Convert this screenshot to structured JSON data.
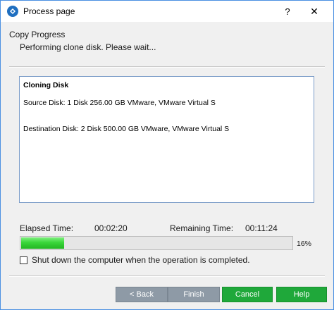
{
  "window": {
    "title": "Process page",
    "help_glyph": "?",
    "close_glyph": "✕",
    "icon": "app-logo-icon"
  },
  "header": {
    "title": "Copy Progress",
    "subtitle": "Performing clone disk. Please wait..."
  },
  "log": {
    "title": "Cloning Disk",
    "source": "Source Disk: 1 Disk 256.00 GB VMware, VMware Virtual S",
    "destination": "Destination Disk: 2 Disk 500.00 GB VMware, VMware Virtual S"
  },
  "progress": {
    "elapsed_label": "Elapsed Time:",
    "elapsed_value": "00:02:20",
    "remaining_label": "Remaining Time:",
    "remaining_value": "00:11:24",
    "percent_text": "16%",
    "percent": 16
  },
  "shutdown": {
    "label": "Shut down the computer when the operation is completed.",
    "checked": false
  },
  "buttons": {
    "back": "< Back",
    "finish": "Finish",
    "cancel": "Cancel",
    "help": "Help"
  },
  "colors": {
    "accent_green": "#1fa83a",
    "disabled_gray": "#8e9aa6",
    "progress_green": "#3ad63a",
    "border_blue": "#4a90e2"
  }
}
